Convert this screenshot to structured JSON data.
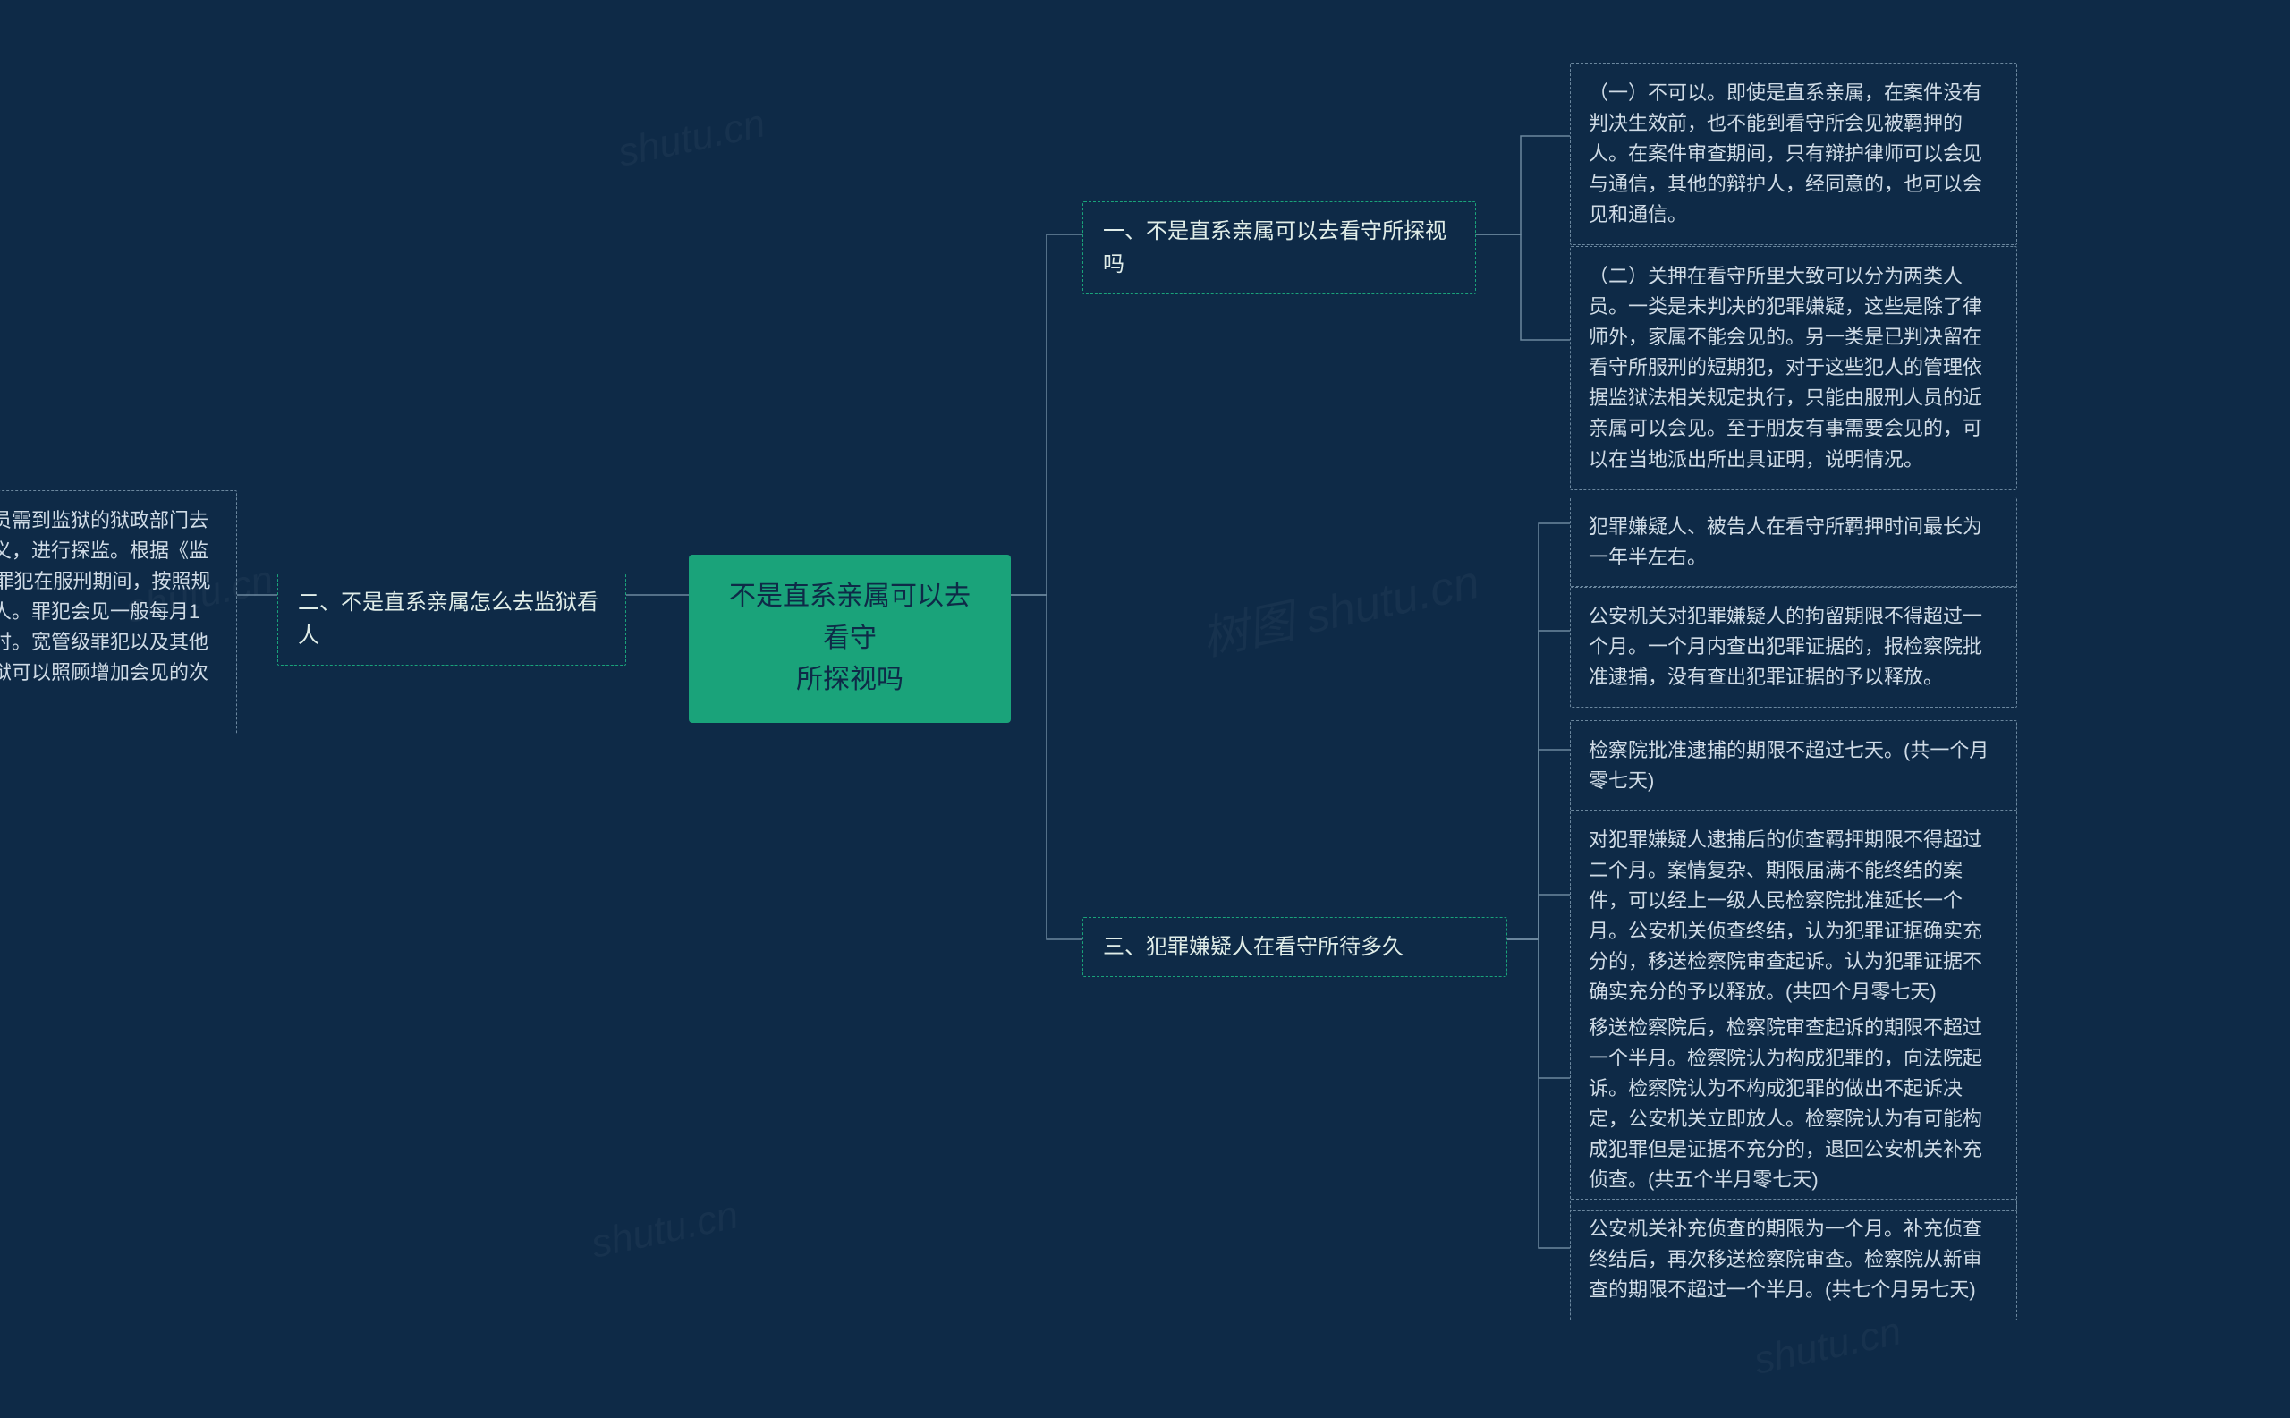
{
  "root": {
    "title_line1": "不是直系亲属可以去看守",
    "title_line2": "所探视吗"
  },
  "branches": {
    "b1": {
      "label": "一、不是直系亲属可以去看守所探视吗"
    },
    "b2": {
      "label": "二、不是直系亲属怎么去监狱看人"
    },
    "b3": {
      "label": "三、犯罪嫌疑人在看守所待多久"
    }
  },
  "leaves": {
    "b1_1": "（一）不可以。即使是直系亲属，在案件没有判决生效前，也不能到看守所会见被羁押的人。在案件审查期间，只有辩护律师可以会见与通信，其他的辩护人，经同意的，也可以会见和通信。",
    "b1_2": "（二）关押在看守所里大致可以分为两类人员。一类是未判决的犯罪嫌疑，这些是除了律师外，家属不能会见的。另一类是已判决留在看守所服刑的短期犯，对于这些犯人的管理依据监狱法相关规定执行，只能由服刑人员的近亲属可以会见。至于朋友有事需要会见的，可以在当地派出所出具证明，说明情况。",
    "b2_1": "非直系亲属探视服刑人员需到监狱的狱政部门去办理手续，以帮教的名义，进行探监。根据《监狱法》第40条的规定，罪犯在服刑期间，按照规定可以会见亲属、监护人。罪犯会见一般每月1次，每次半小时至一小时。宽管级罪犯以及其他有特殊情况的罪犯，监狱可以照顾增加会见的次数和延长会见的时间。",
    "b3_1": "犯罪嫌疑人、被告人在看守所羁押时间最长为一年半左右。",
    "b3_2": "公安机关对犯罪嫌疑人的拘留期限不得超过一个月。一个月内查出犯罪证据的，报检察院批准逮捕，没有查出犯罪证据的予以释放。",
    "b3_3": "检察院批准逮捕的期限不超过七天。(共一个月零七天)",
    "b3_4": "对犯罪嫌疑人逮捕后的侦查羁押期限不得超过二个月。案情复杂、期限届满不能终结的案件，可以经上一级人民检察院批准延长一个月。公安机关侦查终结，认为犯罪证据确实充分的，移送检察院审查起诉。认为犯罪证据不确实充分的予以释放。(共四个月零七天)",
    "b3_5": "移送检察院后，检察院审查起诉的期限不超过一个半月。检察院认为构成犯罪的，向法院起诉。检察院认为不构成犯罪的做出不起诉决定，公安机关立即放人。检察院认为有可能构成犯罪但是证据不充分的，退回公安机关补充侦查。(共五个半月零七天)",
    "b3_6": "公安机关补充侦查的期限为一个月。补充侦查终结后，再次移送检察院审查。检察院从新审查的期限不超过一个半月。(共七个月另七天)"
  },
  "watermarks": [
    "shutu.cn",
    "树图 shutu.cn"
  ]
}
